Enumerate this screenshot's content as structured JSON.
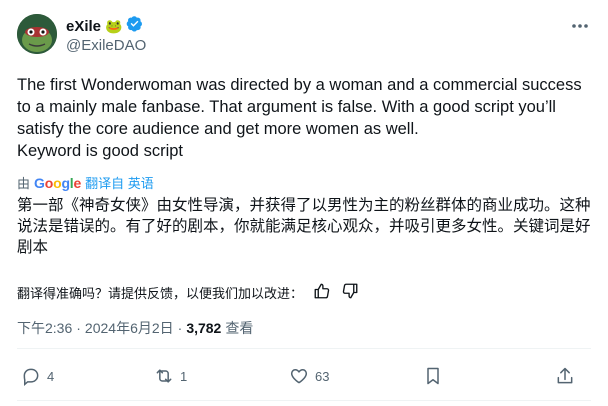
{
  "author": {
    "display_name": "eXile",
    "emoji": "🐸",
    "handle": "@ExileDAO",
    "verified": true
  },
  "tweet": {
    "text": "The first Wonderwoman was directed by a woman and a commercial success to a mainly male fanbase. That argument is false. With a good script you’ll satisfy the core audience and get more women as well.\nKeyword is good script"
  },
  "translation": {
    "by_label": "由",
    "provider": "Google",
    "translated_from": "翻译自 英语",
    "text": "第一部《神奇女侠》由女性导演，并获得了以男性为主的粉丝群体的商业成功。这种说法是错误的。有了好的剧本，你就能满足核心观众，并吸引更多女性。关键词是好剧本"
  },
  "feedback": {
    "question": "翻译得准确吗？请提供反馈，以便我们加以改进："
  },
  "meta": {
    "time": "下午2:36",
    "separator": "·",
    "date": "2024年6月2日",
    "views_count": "3,782",
    "views_label": "查看"
  },
  "actions": {
    "replies": "4",
    "reposts": "1",
    "likes": "63"
  },
  "colors": {
    "verified_blue": "#1d9bf0",
    "text_primary": "#0f1419",
    "text_secondary": "#536471"
  },
  "icons": [
    "more-icon",
    "verified-icon",
    "thumbs-up-icon",
    "thumbs-down-icon",
    "reply-icon",
    "repost-icon",
    "like-icon",
    "bookmark-icon",
    "share-icon"
  ]
}
